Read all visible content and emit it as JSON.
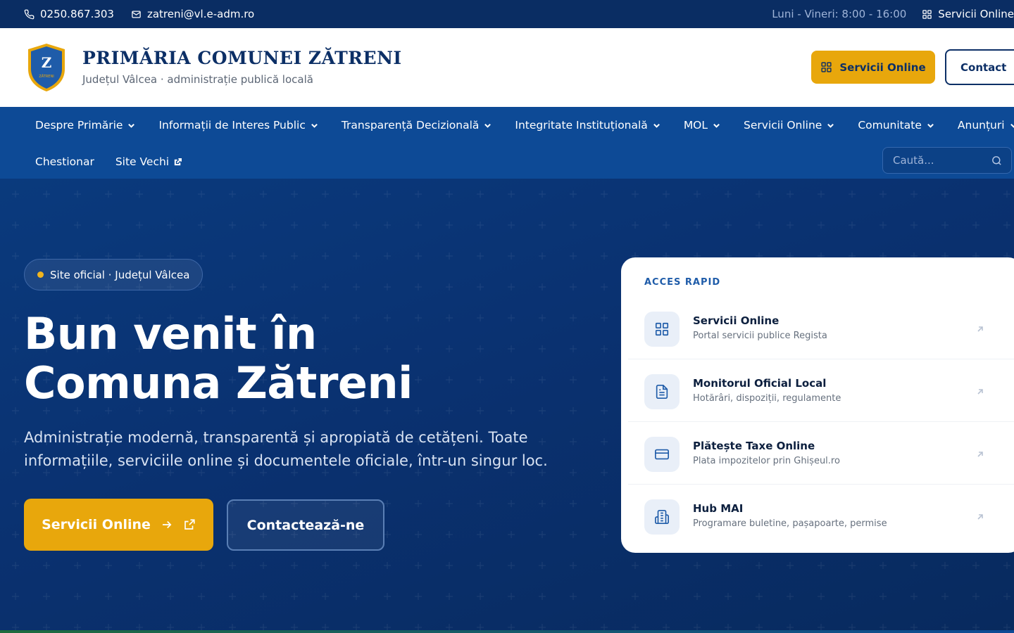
{
  "topbar": {
    "phone": "0250.867.303",
    "email": "zatreni@vl.e-adm.ro",
    "hours": "Luni - Vineri: 8:00 - 16:00",
    "online_services": "Servicii Online"
  },
  "header": {
    "logo_letter": "Z",
    "logo_caption": "ZĂTRENI",
    "title": "PRIMĂRIA COMUNEI ZĂTRENI",
    "subtitle": "Județul Vâlcea · administrație publică locală",
    "services_button": "Servicii Online",
    "contact_button": "Contact"
  },
  "nav": {
    "items": [
      {
        "label": "Despre Primărie"
      },
      {
        "label": "Informații de Interes Public"
      },
      {
        "label": "Transparență Decizională"
      },
      {
        "label": "Integritate Instituțională"
      },
      {
        "label": "MOL"
      },
      {
        "label": "Servicii Online"
      },
      {
        "label": "Comunitate"
      },
      {
        "label": "Anunțuri"
      }
    ],
    "row2": [
      {
        "label": "Chestionar"
      },
      {
        "label": "Site Vechi"
      }
    ],
    "search_placeholder": "Caută..."
  },
  "hero": {
    "badge": "Site oficial · Județul Vâlcea",
    "title_line1": "Bun venit în",
    "title_line2": "Comuna Zătreni",
    "description": "Administrație modernă, transparentă și apropiată de cetățeni. Toate informațiile, serviciile online și documentele oficiale, într-un singur loc.",
    "primary_button": "Servicii Online",
    "secondary_button": "Contactează-ne"
  },
  "quick_access": {
    "title": "ACCES RAPID",
    "items": [
      {
        "title": "Servicii Online",
        "subtitle": "Portal servicii publice Regista",
        "icon": "grid-icon"
      },
      {
        "title": "Monitorul Oficial Local",
        "subtitle": "Hotărâri, dispoziții, regulamente",
        "icon": "document-icon"
      },
      {
        "title": "Plătește Taxe Online",
        "subtitle": "Plata impozitelor prin Ghișeul.ro",
        "icon": "card-icon"
      },
      {
        "title": "Hub MAI",
        "subtitle": "Programare buletine, pașapoarte, permise",
        "icon": "building-icon"
      }
    ]
  },
  "colors": {
    "navy": "#0c2f66",
    "nav_blue": "#0d4a96",
    "accent_yellow": "#e8a70c"
  }
}
